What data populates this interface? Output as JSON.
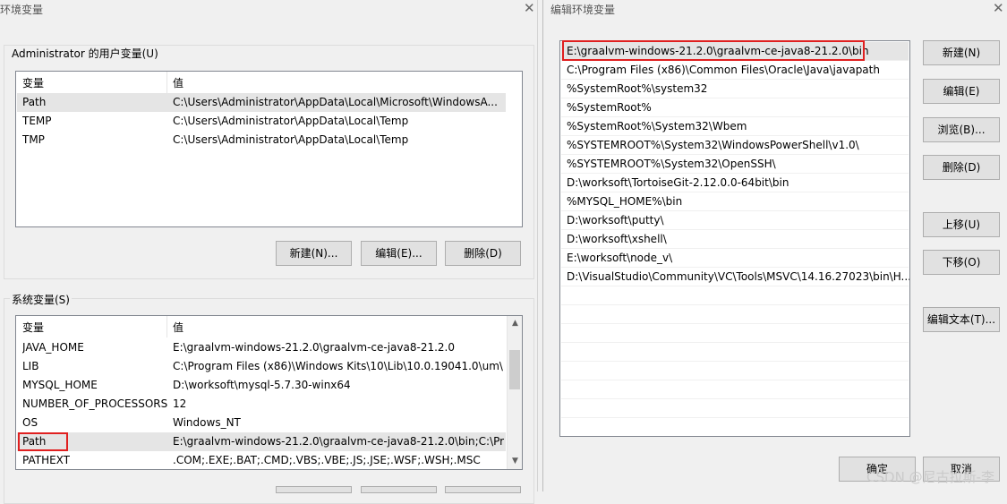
{
  "left_window": {
    "title": "环境变量",
    "close_glyph": "✕",
    "user_group": {
      "label": "Administrator 的用户变量(U)",
      "headers": [
        "变量",
        "值"
      ],
      "rows": [
        {
          "name": "Path",
          "value": "C:\\Users\\Administrator\\AppData\\Local\\Microsoft\\WindowsA..."
        },
        {
          "name": "TEMP",
          "value": "C:\\Users\\Administrator\\AppData\\Local\\Temp"
        },
        {
          "name": "TMP",
          "value": "C:\\Users\\Administrator\\AppData\\Local\\Temp"
        }
      ],
      "buttons": {
        "new": "新建(N)...",
        "edit": "编辑(E)...",
        "delete": "删除(D)"
      }
    },
    "system_group": {
      "label": "系统变量(S)",
      "headers": [
        "变量",
        "值"
      ],
      "rows": [
        {
          "name": "JAVA_HOME",
          "value": "E:\\graalvm-windows-21.2.0\\graalvm-ce-java8-21.2.0"
        },
        {
          "name": "LIB",
          "value": "C:\\Program Files (x86)\\Windows Kits\\10\\Lib\\10.0.19041.0\\um\\..."
        },
        {
          "name": "MYSQL_HOME",
          "value": "D:\\worksoft\\mysql-5.7.30-winx64"
        },
        {
          "name": "NUMBER_OF_PROCESSORS",
          "value": "12"
        },
        {
          "name": "OS",
          "value": "Windows_NT"
        },
        {
          "name": "Path",
          "value": "E:\\graalvm-windows-21.2.0\\graalvm-ce-java8-21.2.0\\bin;C:\\Pr..."
        },
        {
          "name": "PATHEXT",
          "value": ".COM;.EXE;.BAT;.CMD;.VBS;.VBE;.JS;.JSE;.WSF;.WSH;.MSC"
        }
      ]
    }
  },
  "right_window": {
    "title": "编辑环境变量",
    "close_glyph": "✕",
    "path_entries": [
      "E:\\graalvm-windows-21.2.0\\graalvm-ce-java8-21.2.0\\bin",
      "C:\\Program Files (x86)\\Common Files\\Oracle\\Java\\javapath",
      "%SystemRoot%\\system32",
      "%SystemRoot%",
      "%SystemRoot%\\System32\\Wbem",
      "%SYSTEMROOT%\\System32\\WindowsPowerShell\\v1.0\\",
      "%SYSTEMROOT%\\System32\\OpenSSH\\",
      "D:\\worksoft\\TortoiseGit-2.12.0.0-64bit\\bin",
      "%MYSQL_HOME%\\bin",
      "D:\\worksoft\\putty\\",
      "D:\\worksoft\\xshell\\",
      "E:\\worksoft\\node_v\\",
      "D:\\VisualStudio\\Community\\VC\\Tools\\MSVC\\14.16.27023\\bin\\H..."
    ],
    "buttons": {
      "new": "新建(N)",
      "edit": "编辑(E)",
      "browse": "浏览(B)...",
      "delete": "删除(D)",
      "up": "上移(U)",
      "down": "下移(O)",
      "edit_text": "编辑文本(T)...",
      "ok": "确定",
      "cancel": "取消"
    }
  },
  "watermark": "CSDN @尼古拉斯-李",
  "colors": {
    "highlight_box": "#e02020",
    "selected_row": "#e5e5e5"
  }
}
